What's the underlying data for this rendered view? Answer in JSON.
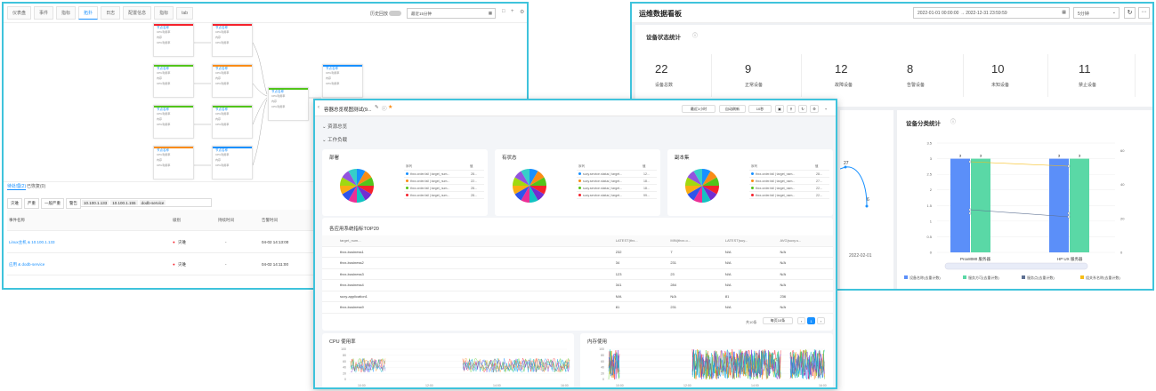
{
  "w1": {
    "tabs": [
      "仪表盘",
      "事件",
      "指标",
      "拓扑",
      "日志",
      "配置信息",
      "指标",
      "tab"
    ],
    "toggle_label": "历史回放",
    "time_range": "最近15分钟",
    "nodes": [
      {
        "title": "节点名称",
        "r1": "CPU利用率",
        "r2": "内存"
      },
      {
        "title": "节点名称",
        "r1": "CPU利用率",
        "r2": "内存"
      },
      {
        "title": "节点名称",
        "r1": "CPU利用率",
        "r2": "内存"
      },
      {
        "title": "节点名称",
        "r1": "CPU利用率",
        "r2": "内存"
      },
      {
        "title": "节点名称",
        "r1": "CPU利用率",
        "r2": "内存"
      },
      {
        "title": "节点名称",
        "r1": "CPU利用率",
        "r2": "内存"
      },
      {
        "title": "节点名称",
        "r1": "CPU利用率",
        "r2": "内存"
      },
      {
        "title": "节点名称",
        "r1": "CPU利用率",
        "r2": "内存"
      },
      {
        "title": "节点名称",
        "r1": "CPU利用率",
        "r2": "内存"
      },
      {
        "title": "节点名称",
        "r1": "CPU利用率",
        "r2": "内存"
      }
    ],
    "bottom_tabs": [
      "待处理(2)",
      "已恢复(0)"
    ],
    "filters": [
      "灾难",
      "严重",
      "一般严重",
      "警告"
    ],
    "ip_tags": [
      "10.100.1.133",
      "10.100.1.155",
      "dodb-service"
    ],
    "columns": [
      "事件名称",
      "级别",
      "持续时间",
      "告警时间"
    ],
    "rows": [
      {
        "name": "Linux主机 & 10.100.1.133",
        "level": "灾难",
        "dur": "-",
        "time": "04-02 14:13:00"
      },
      {
        "name": "应用 & dodb-service",
        "level": "灾难",
        "dur": "-",
        "time": "04-02 14:11:00"
      }
    ]
  },
  "w2": {
    "title": "运维数据看板",
    "start": "2022-01-01 00:00:00",
    "end": "2022-12-31 23:59:59",
    "interval": "5分钟",
    "status_title": "设备状态统计",
    "stats": [
      {
        "n": "22",
        "l": "设备总数"
      },
      {
        "n": "9",
        "l": "正常设备"
      },
      {
        "n": "12",
        "l": "故障设备"
      },
      {
        "n": "8",
        "l": "告警设备"
      },
      {
        "n": "10",
        "l": "未知设备"
      },
      {
        "n": "11",
        "l": "禁止设备"
      }
    ],
    "cat_title": "设备分类统计",
    "side_val1": "27",
    "side_val2": "6",
    "side_date": "2022-02-01"
  },
  "w3": {
    "title": "容器总览视图测试(9...",
    "time_btn": "最近1小时",
    "refresh": "自动刷新",
    "interval": "10秒",
    "groups": [
      "资源总览",
      "工作负载"
    ],
    "pies": [
      {
        "title": "部署"
      },
      {
        "title": "有状态"
      },
      {
        "title": "副本集"
      }
    ],
    "pie_legend_head": [
      "序列",
      "值"
    ],
    "pie_legends": [
      [
        {
          "s": "thxx.order.fail | target_num...",
          "v": "28...",
          "c": "#1890ff"
        },
        {
          "s": "thxx.order.fail | target_num...",
          "v": "22...",
          "c": "#fa8c16"
        },
        {
          "s": "thxx.order.fail | target_num...",
          "v": "28...",
          "c": "#52c41a"
        },
        {
          "s": "thxx.order.fail | target_num...",
          "v": "28...",
          "c": "#f5222d"
        }
      ],
      [
        {
          "s": "suxy.service.status | target...",
          "v": "12...",
          "c": "#1890ff"
        },
        {
          "s": "suxy.service.status | target...",
          "v": "18...",
          "c": "#fa8c16"
        },
        {
          "s": "suxy.service.status | target...",
          "v": "18...",
          "c": "#52c41a"
        },
        {
          "s": "suxy.service.status | target...",
          "v": "99...",
          "c": "#f5222d"
        }
      ],
      [
        {
          "s": "thxx.order.fail | target_nam...",
          "v": "28...",
          "c": "#1890ff"
        },
        {
          "s": "thxx.order.fail | target_nam...",
          "v": "27...",
          "c": "#fa8c16"
        },
        {
          "s": "thxx.order.fail | target_nam...",
          "v": "22...",
          "c": "#52c41a"
        },
        {
          "s": "thxx.order.fail | target_nam...",
          "v": "22...",
          "c": "#f5222d"
        }
      ]
    ],
    "table_title": "各应用系统指标TOP20",
    "table_cols": [
      "target_num...",
      "LATEST(thx...",
      "MIN(thxx.o...",
      "LATEST(suy...",
      "AVG(suxy.s..."
    ],
    "table_rows": [
      [
        "thxx-business1",
        "232",
        "7",
        "N/A",
        "N/A"
      ],
      [
        "thxx-business2",
        "34",
        "231",
        "N/A",
        "N/A"
      ],
      [
        "thxx-business3",
        "123",
        "23",
        "N/A",
        "N/A"
      ],
      [
        "thxx-business4",
        "341",
        "284",
        "N/A",
        "N/A"
      ],
      [
        "suxy-application1",
        "N/A",
        "N/A",
        "81",
        "236"
      ],
      [
        "thxx-business9",
        "81",
        "231",
        "N/A",
        "N/A"
      ]
    ],
    "pager_total": "共10条",
    "pager_size": "每页10条",
    "page": "1",
    "cpu_title": "CPU 使用率",
    "mem_title": "内存使用",
    "cpu_ticks": [
      "10:00",
      "12:00",
      "14:00",
      "16:00"
    ],
    "mem_ticks": [
      "10:00",
      "12:00",
      "14:00",
      "16:00"
    ]
  }
}
